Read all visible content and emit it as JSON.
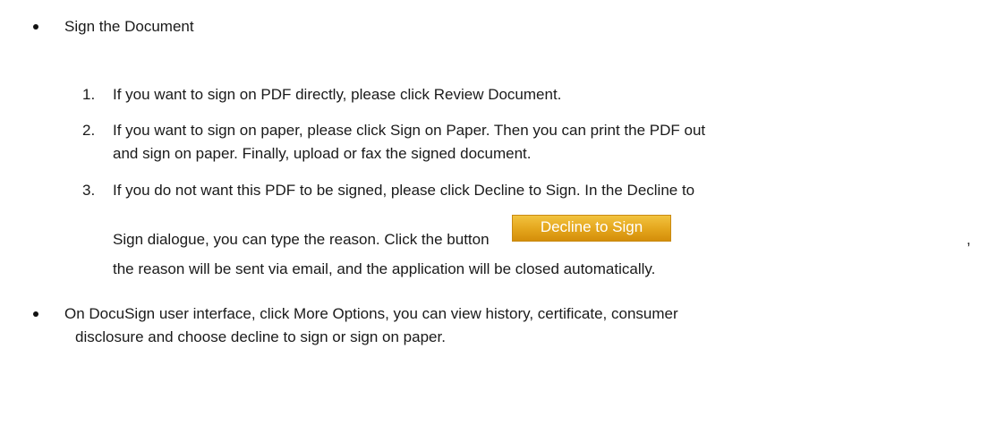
{
  "document": {
    "bullet1": "Sign the Document",
    "items": [
      {
        "num": "1.",
        "lines": [
          "If you want to sign on PDF directly, please click Review Document."
        ]
      },
      {
        "num": "2.",
        "lines": [
          "If you want to sign on paper, please click Sign on Paper. Then you can print the PDF out",
          "and sign on paper. Finally, upload or fax the signed document."
        ]
      },
      {
        "num": "3.",
        "lines": [
          "If you do not want this PDF to be signed, please click Decline to Sign. In the Decline to",
          "Sign dialogue, you can type the reason. Click the button",
          ",",
          "the reason will be sent via email, and the application will be closed automatically."
        ]
      }
    ],
    "decline_button_label": "Decline to Sign",
    "bullet2_lines": [
      "On DocuSign user interface, click More Options, you can view history, certificate, consumer",
      "disclosure and choose decline to sign or sign on paper."
    ]
  }
}
